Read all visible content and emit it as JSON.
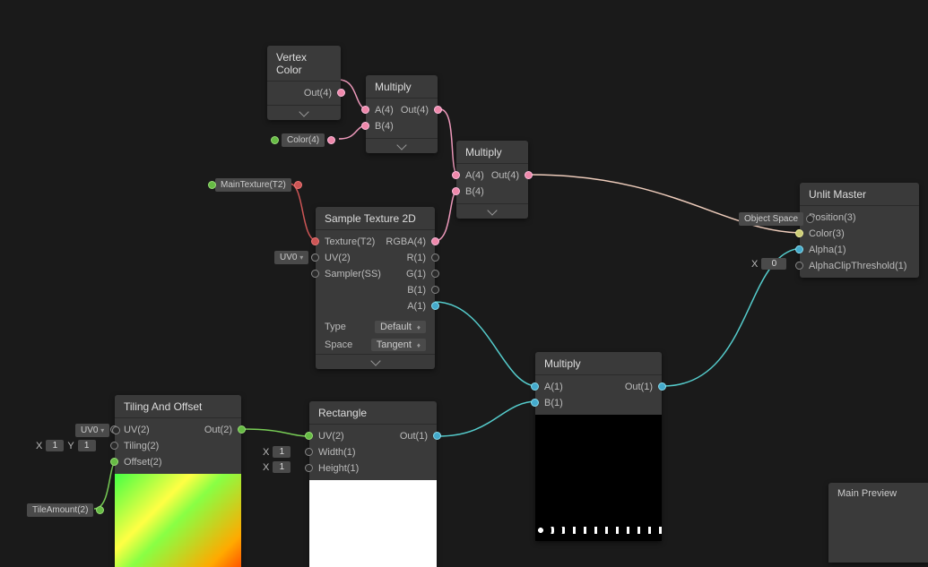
{
  "nodes": {
    "vertexColor": {
      "title": "Vertex Color",
      "out": "Out(4)"
    },
    "multiply1": {
      "title": "Multiply",
      "a": "A(4)",
      "b": "B(4)",
      "out": "Out(4)"
    },
    "multiply2": {
      "title": "Multiply",
      "a": "A(4)",
      "b": "B(4)",
      "out": "Out(4)"
    },
    "multiply3": {
      "title": "Multiply",
      "a": "A(1)",
      "b": "B(1)",
      "out": "Out(1)"
    },
    "sampleTex": {
      "title": "Sample Texture 2D",
      "texture": "Texture(T2)",
      "uv": "UV(2)",
      "sampler": "Sampler(SS)",
      "rgba": "RGBA(4)",
      "r": "R(1)",
      "g": "G(1)",
      "b": "B(1)",
      "a": "A(1)",
      "typeLabel": "Type",
      "typeValue": "Default",
      "spaceLabel": "Space",
      "spaceValue": "Tangent"
    },
    "tiling": {
      "title": "Tiling And Offset",
      "uv": "UV(2)",
      "tiling": "Tiling(2)",
      "offset": "Offset(2)",
      "out": "Out(2)"
    },
    "rectangle": {
      "title": "Rectangle",
      "uv": "UV(2)",
      "width": "Width(1)",
      "height": "Height(1)",
      "out": "Out(1)"
    },
    "unlit": {
      "title": "Unlit Master",
      "position": "Position(3)",
      "color": "Color(3)",
      "alpha": "Alpha(1)",
      "alphaClip": "AlphaClipThreshold(1)"
    }
  },
  "tags": {
    "color4": "Color(4)",
    "mainTexture": "MainTexture(T2)",
    "uv0_a": "UV0",
    "uv0_b": "UV0",
    "tileAmount": "TileAmount(2)",
    "objectSpace": "Object Space"
  },
  "inlineInputs": {
    "tilingX": "X",
    "tilingXVal": "1",
    "tilingY": "Y",
    "tilingYVal": "1",
    "rectW": "X",
    "rectWVal": "1",
    "rectH": "X",
    "rectHVal": "1",
    "alphaClipX": "X",
    "alphaClipXVal": "0"
  },
  "mainPreview": "Main Preview"
}
